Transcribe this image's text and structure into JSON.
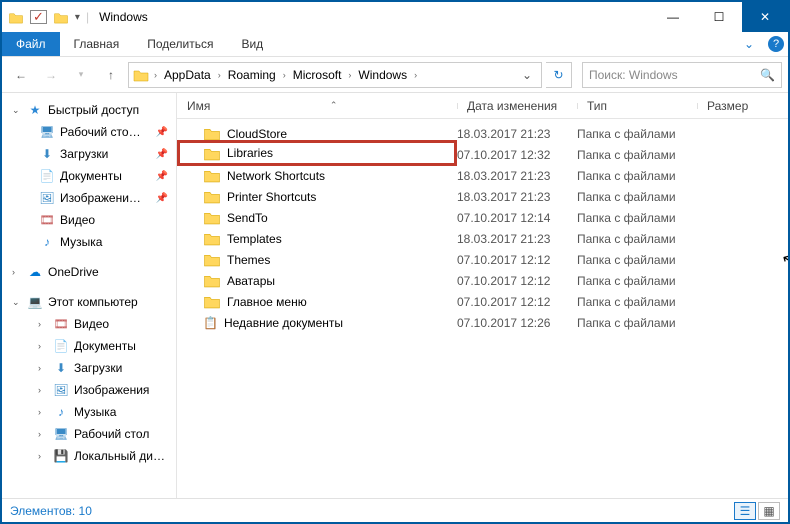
{
  "window": {
    "title": "Windows"
  },
  "ribbon": {
    "file": "Файл",
    "home": "Главная",
    "share": "Поделиться",
    "view": "Вид"
  },
  "breadcrumbs": [
    "AppData",
    "Roaming",
    "Microsoft",
    "Windows"
  ],
  "search": {
    "placeholder": "Поиск: Windows"
  },
  "columns": {
    "name": "Имя",
    "date": "Дата изменения",
    "type": "Тип",
    "size": "Размер"
  },
  "sidebar": {
    "quick": {
      "label": "Быстрый доступ",
      "items": [
        {
          "label": "Рабочий сто…",
          "icon": "desktop",
          "pin": true
        },
        {
          "label": "Загрузки",
          "icon": "downloads",
          "pin": true
        },
        {
          "label": "Документы",
          "icon": "documents",
          "pin": true
        },
        {
          "label": "Изображени…",
          "icon": "images",
          "pin": true
        },
        {
          "label": "Видео",
          "icon": "video",
          "pin": false
        },
        {
          "label": "Музыка",
          "icon": "music",
          "pin": false
        }
      ]
    },
    "onedrive": {
      "label": "OneDrive"
    },
    "pc": {
      "label": "Этот компьютер",
      "items": [
        {
          "label": "Видео",
          "icon": "video"
        },
        {
          "label": "Документы",
          "icon": "documents"
        },
        {
          "label": "Загрузки",
          "icon": "downloads"
        },
        {
          "label": "Изображения",
          "icon": "images"
        },
        {
          "label": "Музыка",
          "icon": "music"
        },
        {
          "label": "Рабочий стол",
          "icon": "desktop"
        },
        {
          "label": "Локальный ди…",
          "icon": "disk"
        }
      ]
    }
  },
  "files": [
    {
      "name": "CloudStore",
      "date": "18.03.2017 21:23",
      "type": "Папка с файлами",
      "icon": "folder"
    },
    {
      "name": "Libraries",
      "date": "07.10.2017 12:32",
      "type": "Папка с файлами",
      "icon": "folder",
      "highlight": true
    },
    {
      "name": "Network Shortcuts",
      "date": "18.03.2017 21:23",
      "type": "Папка с файлами",
      "icon": "folder"
    },
    {
      "name": "Printer Shortcuts",
      "date": "18.03.2017 21:23",
      "type": "Папка с файлами",
      "icon": "folder"
    },
    {
      "name": "SendTo",
      "date": "07.10.2017 12:14",
      "type": "Папка с файлами",
      "icon": "folder"
    },
    {
      "name": "Templates",
      "date": "18.03.2017 21:23",
      "type": "Папка с файлами",
      "icon": "folder"
    },
    {
      "name": "Themes",
      "date": "07.10.2017 12:12",
      "type": "Папка с файлами",
      "icon": "folder"
    },
    {
      "name": "Аватары",
      "date": "07.10.2017 12:12",
      "type": "Папка с файлами",
      "icon": "folder"
    },
    {
      "name": "Главное меню",
      "date": "07.10.2017 12:12",
      "type": "Папка с файлами",
      "icon": "folder"
    },
    {
      "name": "Недавние документы",
      "date": "07.10.2017 12:26",
      "type": "Папка с файлами",
      "icon": "recent"
    }
  ],
  "status": {
    "text": "Элементов: 10"
  },
  "icons": {
    "desktop": "🖥",
    "downloads": "⬇",
    "documents": "📄",
    "images": "🖼",
    "video": "🎞",
    "music": "♪",
    "disk": "💾",
    "recent": "📋",
    "star": "★",
    "cloud": "☁",
    "pc": "💻"
  }
}
